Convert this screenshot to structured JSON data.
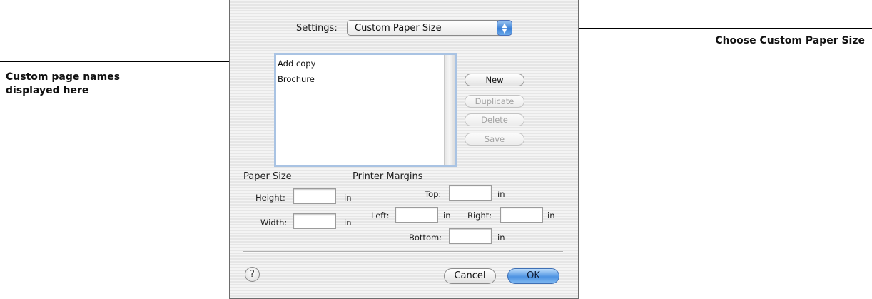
{
  "callouts": {
    "right": "Choose Custom Paper Size",
    "left_line1": "Custom page names",
    "left_line2": "displayed here"
  },
  "settings": {
    "label": "Settings:",
    "selected": "Custom Paper Size"
  },
  "page_list": {
    "items": [
      "Add copy",
      "Brochure"
    ]
  },
  "side_buttons": {
    "new": "New",
    "duplicate": "Duplicate",
    "delete": "Delete",
    "save": "Save"
  },
  "paper_size": {
    "heading": "Paper Size",
    "height_label": "Height:",
    "width_label": "Width:",
    "unit": "in"
  },
  "printer_margins": {
    "heading": "Printer Margins",
    "top_label": "Top:",
    "left_label": "Left:",
    "right_label": "Right:",
    "bottom_label": "Bottom:",
    "unit": "in"
  },
  "footer": {
    "help": "?",
    "cancel": "Cancel",
    "ok": "OK"
  }
}
